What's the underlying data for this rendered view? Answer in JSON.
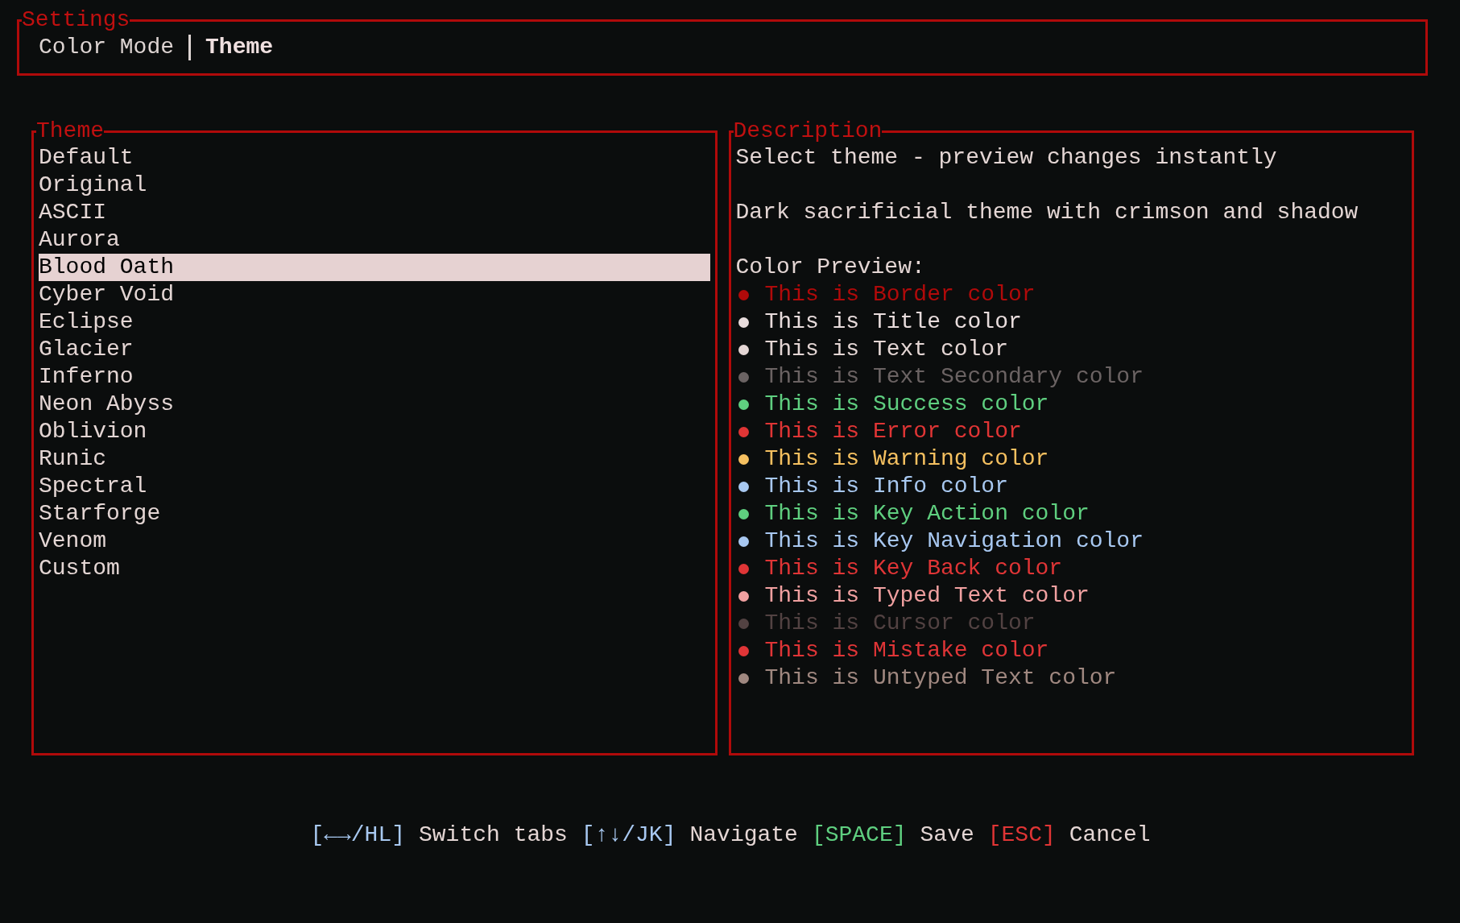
{
  "settings": {
    "title": "Settings",
    "tabs": [
      {
        "label": "Color Mode",
        "selected": false
      },
      {
        "label": "Theme",
        "selected": true
      }
    ]
  },
  "theme_panel": {
    "title": "Theme",
    "items": [
      {
        "label": "Default",
        "selected": false
      },
      {
        "label": "Original",
        "selected": false
      },
      {
        "label": "ASCII",
        "selected": false
      },
      {
        "label": "Aurora",
        "selected": false
      },
      {
        "label": "Blood Oath",
        "selected": true
      },
      {
        "label": "Cyber Void",
        "selected": false
      },
      {
        "label": "Eclipse",
        "selected": false
      },
      {
        "label": "Glacier",
        "selected": false
      },
      {
        "label": "Inferno",
        "selected": false
      },
      {
        "label": "Neon Abyss",
        "selected": false
      },
      {
        "label": "Oblivion",
        "selected": false
      },
      {
        "label": "Runic",
        "selected": false
      },
      {
        "label": "Spectral",
        "selected": false
      },
      {
        "label": "Starforge",
        "selected": false
      },
      {
        "label": "Venom",
        "selected": false
      },
      {
        "label": "Custom",
        "selected": false
      }
    ]
  },
  "description_panel": {
    "title": "Description",
    "hint": "Select theme - preview changes instantly",
    "description": "Dark sacrificial theme with crimson and shadow",
    "preview_heading": "Color Preview:",
    "preview": [
      {
        "label": "This is Border color",
        "color": "#b00a0a"
      },
      {
        "label": "This is Title color",
        "color": "#e8dcdc"
      },
      {
        "label": "This is Text color",
        "color": "#e4d6d4"
      },
      {
        "label": "This is Text Secondary color",
        "color": "#6b6363"
      },
      {
        "label": "This is Success color",
        "color": "#5fcf80"
      },
      {
        "label": "This is Error color",
        "color": "#e03535"
      },
      {
        "label": "This is Warning color",
        "color": "#f5c060"
      },
      {
        "label": "This is Info color",
        "color": "#a8c8f0"
      },
      {
        "label": "This is Key Action color",
        "color": "#5fcf7f"
      },
      {
        "label": "This is Key Navigation color",
        "color": "#a8c8f1"
      },
      {
        "label": "This is Key Back color",
        "color": "#e03536"
      },
      {
        "label": "This is Typed Text color",
        "color": "#f0a0a0"
      },
      {
        "label": "This is Cursor color",
        "color": "#524242"
      },
      {
        "label": "This is Mistake color",
        "color": "#e03537"
      },
      {
        "label": "This is Untyped Text color",
        "color": "#a08880"
      }
    ]
  },
  "footer": [
    {
      "key": "[←→/HL]",
      "color": "#a8c8f0",
      "label": "Switch tabs"
    },
    {
      "key": "[↑↓/JK]",
      "color": "#a8c8f1",
      "label": "Navigate"
    },
    {
      "key": "[SPACE]",
      "color": "#5fcf80",
      "label": "Save"
    },
    {
      "key": "[ESC]",
      "color": "#e03535",
      "label": "Cancel"
    }
  ]
}
